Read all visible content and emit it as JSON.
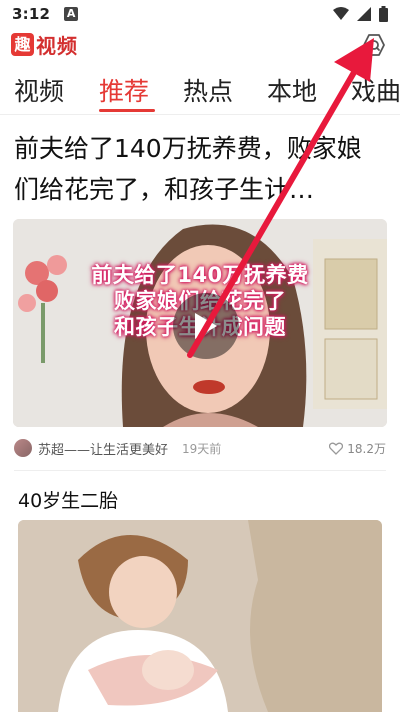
{
  "status_bar": {
    "time": "3:12",
    "notif_letter": "A"
  },
  "app": {
    "logo_text": "趣视频"
  },
  "tabs": [
    "视频",
    "推荐",
    "热点",
    "本地",
    "戏曲"
  ],
  "active_tab": "推荐",
  "feed": [
    {
      "title": "前夫给了140万抚养费，败家娘们给花完了，和孩子生计…",
      "overlay_lines": [
        "前夫给了140万抚养费",
        "败家娘们给花完了",
        "和孩子生计成问题"
      ],
      "author": "苏超——让生活更美好",
      "time": "19天前",
      "likes": "18.2万"
    },
    {
      "title": "40岁生二胎"
    }
  ],
  "colors": {
    "accent": "#e53935",
    "annotation_arrow": "#e8193c"
  },
  "icons": {
    "settings": "hexagon-search-icon",
    "play": "play-icon",
    "like": "heart-outline-icon"
  }
}
